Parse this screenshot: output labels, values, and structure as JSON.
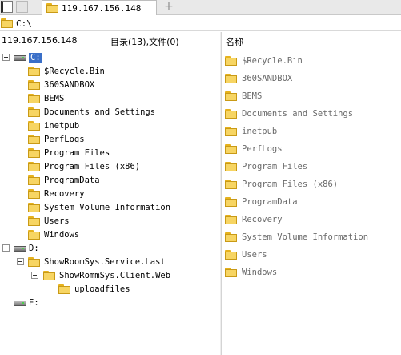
{
  "tab": {
    "title": "119.167.156.148",
    "add": "+"
  },
  "path": {
    "value": "C:\\"
  },
  "header": {
    "host": "119.167.156.148",
    "counts": "目录(13),文件(0)",
    "name_column": "名称"
  },
  "tree": {
    "c_drive": "C:",
    "c_children": [
      "$Recycle.Bin",
      "360SANDBOX",
      "BEMS",
      "Documents and Settings",
      "inetpub",
      "PerfLogs",
      "Program Files",
      "Program Files (x86)",
      "ProgramData",
      "Recovery",
      "System Volume Information",
      "Users",
      "Windows"
    ],
    "d_drive": "D:",
    "d_child": "ShowRoomSys.Service.Last",
    "d_grandchild": "ShowRommSys.Client.Web",
    "d_leaf": "uploadfiles",
    "e_drive": "E:"
  },
  "list": {
    "items": [
      "$Recycle.Bin",
      "360SANDBOX",
      "BEMS",
      "Documents and Settings",
      "inetpub",
      "PerfLogs",
      "Program Files",
      "Program Files (x86)",
      "ProgramData",
      "Recovery",
      "System Volume Information",
      "Users",
      "Windows"
    ]
  },
  "icons": {
    "folder": "folder-icon",
    "drive": "drive-icon",
    "expander": "collapse-icon"
  },
  "colors": {
    "selection": "#3a6fc8",
    "folder": "#f7d563",
    "list_text": "#6a6a6a"
  }
}
